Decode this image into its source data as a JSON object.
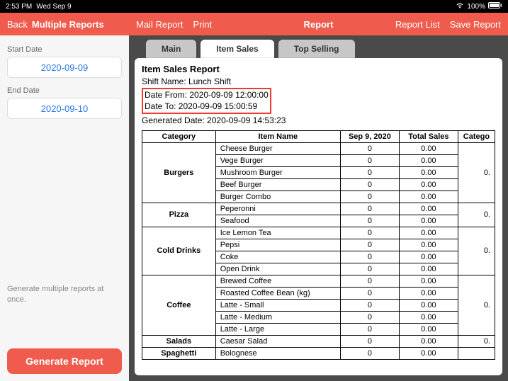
{
  "status": {
    "time": "2:53 PM",
    "date": "Wed Sep 9",
    "battery": "100%"
  },
  "sidebar": {
    "back": "Back",
    "title": "Multiple Reports",
    "start_label": "Start Date",
    "start_value": "2020-09-09",
    "end_label": "End Date",
    "end_value": "2020-09-10",
    "hint": "Generate multiple reports at once.",
    "generate": "Generate Report"
  },
  "header": {
    "mail": "Mail Report",
    "print": "Print",
    "center": "Report",
    "list": "Report List",
    "save": "Save Report"
  },
  "tabs": {
    "main": "Main",
    "item_sales": "Item Sales",
    "top": "Top Selling"
  },
  "report": {
    "title": "Item Sales Report",
    "shift": "Shift Name: Lunch Shift",
    "date_from": "Date From: 2020-09-09 12:00:00",
    "date_to": "Date To: 2020-09-09 15:00:59",
    "generated": "Generated Date: 2020-09-09 14:53:23"
  },
  "table": {
    "headers": {
      "category": "Category",
      "item": "Item Name",
      "date": "Sep 9, 2020",
      "total": "Total Sales",
      "extra": "Catego"
    },
    "groups": [
      {
        "category": "Burgers",
        "extra": "0.",
        "items": [
          {
            "name": "Cheese Burger",
            "qty": "0",
            "total": "0.00"
          },
          {
            "name": "Vege Burger",
            "qty": "0",
            "total": "0.00"
          },
          {
            "name": "Mushroom Burger",
            "qty": "0",
            "total": "0.00"
          },
          {
            "name": "Beef Burger",
            "qty": "0",
            "total": "0.00"
          },
          {
            "name": "Burger Combo",
            "qty": "0",
            "total": "0.00"
          }
        ]
      },
      {
        "category": "Pizza",
        "extra": "0.",
        "items": [
          {
            "name": "Peperonni",
            "qty": "0",
            "total": "0.00"
          },
          {
            "name": "Seafood",
            "qty": "0",
            "total": "0.00"
          }
        ]
      },
      {
        "category": "Cold Drinks",
        "extra": "0.",
        "items": [
          {
            "name": "Ice Lemon Tea",
            "qty": "0",
            "total": "0.00"
          },
          {
            "name": "Pepsi",
            "qty": "0",
            "total": "0.00"
          },
          {
            "name": "Coke",
            "qty": "0",
            "total": "0.00"
          },
          {
            "name": "Open Drink",
            "qty": "0",
            "total": "0.00"
          }
        ]
      },
      {
        "category": "Coffee",
        "extra": "0.",
        "items": [
          {
            "name": "Brewed Coffee",
            "qty": "0",
            "total": "0.00"
          },
          {
            "name": "Roasted Coffee Bean (kg)",
            "qty": "0",
            "total": "0.00"
          },
          {
            "name": "Latte - Small",
            "qty": "0",
            "total": "0.00"
          },
          {
            "name": "Latte - Medium",
            "qty": "0",
            "total": "0.00"
          },
          {
            "name": "Latte - Large",
            "qty": "0",
            "total": "0.00"
          }
        ]
      },
      {
        "category": "Salads",
        "extra": "0.",
        "items": [
          {
            "name": "Caesar Salad",
            "qty": "0",
            "total": "0.00"
          }
        ]
      },
      {
        "category": "Spaghetti",
        "extra": "",
        "items": [
          {
            "name": "Bolognese",
            "qty": "0",
            "total": "0.00"
          }
        ]
      }
    ]
  }
}
